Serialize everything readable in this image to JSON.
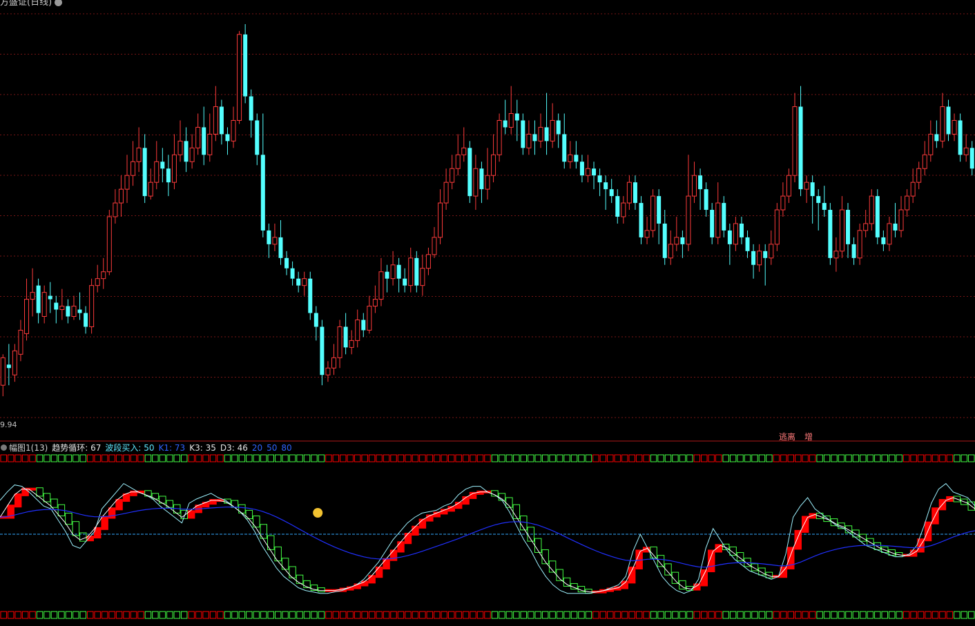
{
  "title": "方盛证(日线)",
  "price_axis_label": "9.94",
  "signals": [
    {
      "text": "逃离"
    },
    {
      "text": "增"
    }
  ],
  "indicator": {
    "name": "幅图1(13)",
    "values": [
      {
        "label": "趋势循环: 67",
        "color": "#e6e6e6"
      },
      {
        "label": "波段买入: 50",
        "color": "#5fe8ff"
      },
      {
        "label": "K1: 73",
        "color": "#2e64ff"
      },
      {
        "label": "K3: 35",
        "color": "#e6e6e6"
      },
      {
        "label": "D3: 46",
        "color": "#e6e6e6"
      },
      {
        "label": "20",
        "color": "#2e64ff"
      },
      {
        "label": "50",
        "color": "#2e64ff"
      },
      {
        "label": "80",
        "color": "#2e64ff"
      }
    ]
  },
  "colors": {
    "up": "#ff3b3b",
    "down": "#54ffff",
    "grid": "#7a1616",
    "cycle_up": "#ff0000",
    "cycle_down": "#44ff44",
    "k_line": "#9ef2ff",
    "d_line": "#ffffff",
    "slow_line": "#2030ff",
    "mid_line": "#33aaff"
  },
  "chart_data": {
    "type": "candlestick",
    "price_range": [
      9.6,
      15.5
    ],
    "candles": [
      [
        10.1,
        10.5,
        10.55,
        9.94
      ],
      [
        10.4,
        10.35,
        10.7,
        10.1
      ],
      [
        10.25,
        10.6,
        10.7,
        10.15
      ],
      [
        10.55,
        10.9,
        11.05,
        10.45
      ],
      [
        10.85,
        11.35,
        11.65,
        10.75
      ],
      [
        11.35,
        11.45,
        11.8,
        11.1
      ],
      [
        11.55,
        11.15,
        11.65,
        11.0
      ],
      [
        11.1,
        11.45,
        11.55,
        11.0
      ],
      [
        11.4,
        11.35,
        11.6,
        11.15
      ],
      [
        11.3,
        11.2,
        11.4,
        11.0
      ],
      [
        11.2,
        11.25,
        11.5,
        11.05
      ],
      [
        11.25,
        11.1,
        11.35,
        11.0
      ],
      [
        11.1,
        11.25,
        11.4,
        11.05
      ],
      [
        11.2,
        11.15,
        11.45,
        11.05
      ],
      [
        11.15,
        10.95,
        11.25,
        10.85
      ],
      [
        10.95,
        11.55,
        11.65,
        10.85
      ],
      [
        11.55,
        11.65,
        11.85,
        11.45
      ],
      [
        11.65,
        11.75,
        11.95,
        11.5
      ],
      [
        11.75,
        12.55,
        12.65,
        11.7
      ],
      [
        12.55,
        12.75,
        12.95,
        12.45
      ],
      [
        12.75,
        12.95,
        13.15,
        12.55
      ],
      [
        12.95,
        13.15,
        13.45,
        12.75
      ],
      [
        13.15,
        13.35,
        13.65,
        13.0
      ],
      [
        13.35,
        13.55,
        13.85,
        13.2
      ],
      [
        13.55,
        12.85,
        13.75,
        12.75
      ],
      [
        12.85,
        13.05,
        13.25,
        12.8
      ],
      [
        13.05,
        13.35,
        13.65,
        12.95
      ],
      [
        13.35,
        13.25,
        13.55,
        13.05
      ],
      [
        13.25,
        13.05,
        13.45,
        12.85
      ],
      [
        13.05,
        13.45,
        13.75,
        12.95
      ],
      [
        13.45,
        13.65,
        13.95,
        13.35
      ],
      [
        13.65,
        13.35,
        13.85,
        13.2
      ],
      [
        13.35,
        13.55,
        13.75,
        13.25
      ],
      [
        13.55,
        13.85,
        14.05,
        13.45
      ],
      [
        13.85,
        13.45,
        14.15,
        13.3
      ],
      [
        13.45,
        13.75,
        14.05,
        13.35
      ],
      [
        13.75,
        14.15,
        14.45,
        13.65
      ],
      [
        14.15,
        13.75,
        14.25,
        13.6
      ],
      [
        13.75,
        13.65,
        13.85,
        13.45
      ],
      [
        13.65,
        13.95,
        14.15,
        13.55
      ],
      [
        13.95,
        15.2,
        15.25,
        13.9
      ],
      [
        15.2,
        14.3,
        15.35,
        14.2
      ],
      [
        14.3,
        13.95,
        14.4,
        13.7
      ],
      [
        13.95,
        13.45,
        14.05,
        13.3
      ],
      [
        13.45,
        12.35,
        14.05,
        12.25
      ],
      [
        12.35,
        12.15,
        12.45,
        11.95
      ],
      [
        12.15,
        12.25,
        12.45,
        12.05
      ],
      [
        12.25,
        11.95,
        12.5,
        11.85
      ],
      [
        11.95,
        11.8,
        12.05,
        11.7
      ],
      [
        11.8,
        11.65,
        11.9,
        11.55
      ],
      [
        11.65,
        11.55,
        11.75,
        11.45
      ],
      [
        11.55,
        11.65,
        11.75,
        11.4
      ],
      [
        11.65,
        11.15,
        11.75,
        11.05
      ],
      [
        11.15,
        10.95,
        11.25,
        10.75
      ],
      [
        10.95,
        10.25,
        11.05,
        10.1
      ],
      [
        10.25,
        10.35,
        10.45,
        10.15
      ],
      [
        10.35,
        10.5,
        10.7,
        10.25
      ],
      [
        10.5,
        10.95,
        11.05,
        10.35
      ],
      [
        10.95,
        10.65,
        11.15,
        10.55
      ],
      [
        10.65,
        10.75,
        10.9,
        10.55
      ],
      [
        10.75,
        11.05,
        11.2,
        10.65
      ],
      [
        11.05,
        10.9,
        11.15,
        10.8
      ],
      [
        10.9,
        11.25,
        11.4,
        10.85
      ],
      [
        11.25,
        11.35,
        11.55,
        11.15
      ],
      [
        11.35,
        11.75,
        11.95,
        11.25
      ],
      [
        11.75,
        11.65,
        11.85,
        11.45
      ],
      [
        11.65,
        11.85,
        12.05,
        11.55
      ],
      [
        11.85,
        11.65,
        11.95,
        11.45
      ],
      [
        11.65,
        11.55,
        11.8,
        11.45
      ],
      [
        11.55,
        11.95,
        12.1,
        11.45
      ],
      [
        11.95,
        11.55,
        12.05,
        11.45
      ],
      [
        11.55,
        11.8,
        12.0,
        11.4
      ],
      [
        11.8,
        12.0,
        12.1,
        11.7
      ],
      [
        12.0,
        12.25,
        12.4,
        11.95
      ],
      [
        12.25,
        12.75,
        12.95,
        12.15
      ],
      [
        12.75,
        13.05,
        13.25,
        12.65
      ],
      [
        13.05,
        13.25,
        13.45,
        12.95
      ],
      [
        13.25,
        13.45,
        13.75,
        13.15
      ],
      [
        13.45,
        13.55,
        13.85,
        13.35
      ],
      [
        13.55,
        12.85,
        13.65,
        12.75
      ],
      [
        12.85,
        13.25,
        13.45,
        12.65
      ],
      [
        13.25,
        12.95,
        13.35,
        12.75
      ],
      [
        12.95,
        13.15,
        13.55,
        12.8
      ],
      [
        13.15,
        13.45,
        13.75,
        13.05
      ],
      [
        13.45,
        13.95,
        14.05,
        13.35
      ],
      [
        13.95,
        13.85,
        14.25,
        13.75
      ],
      [
        13.85,
        14.05,
        14.45,
        13.75
      ],
      [
        14.05,
        13.95,
        14.25,
        13.65
      ],
      [
        13.95,
        13.55,
        14.05,
        13.45
      ],
      [
        13.55,
        13.75,
        13.95,
        13.45
      ],
      [
        13.75,
        13.65,
        13.95,
        13.45
      ],
      [
        13.65,
        13.85,
        14.05,
        13.55
      ],
      [
        13.85,
        13.65,
        14.35,
        13.45
      ],
      [
        13.65,
        13.95,
        14.2,
        13.55
      ],
      [
        13.95,
        13.75,
        14.05,
        13.55
      ],
      [
        13.75,
        13.35,
        14.05,
        13.25
      ],
      [
        13.35,
        13.45,
        13.65,
        13.25
      ],
      [
        13.45,
        13.35,
        13.65,
        13.25
      ],
      [
        13.35,
        13.15,
        13.45,
        13.05
      ],
      [
        13.15,
        13.25,
        13.45,
        13.05
      ],
      [
        13.25,
        13.15,
        13.35,
        12.95
      ],
      [
        13.15,
        13.05,
        13.25,
        12.85
      ],
      [
        13.05,
        12.95,
        13.15,
        12.65
      ],
      [
        12.95,
        12.85,
        13.1,
        12.75
      ],
      [
        12.85,
        12.55,
        12.95,
        12.45
      ],
      [
        12.55,
        12.75,
        12.85,
        12.45
      ],
      [
        12.75,
        13.05,
        13.15,
        12.65
      ],
      [
        13.05,
        12.75,
        13.15,
        12.65
      ],
      [
        12.75,
        12.25,
        12.85,
        12.15
      ],
      [
        12.25,
        12.35,
        12.55,
        12.15
      ],
      [
        12.35,
        12.85,
        12.95,
        12.25
      ],
      [
        12.85,
        12.45,
        12.95,
        12.15
      ],
      [
        12.45,
        11.95,
        12.65,
        11.85
      ],
      [
        11.95,
        12.15,
        12.35,
        11.85
      ],
      [
        12.15,
        12.25,
        12.55,
        12.05
      ],
      [
        12.25,
        12.15,
        12.35,
        11.95
      ],
      [
        12.15,
        12.85,
        13.45,
        12.05
      ],
      [
        12.85,
        13.15,
        13.35,
        12.75
      ],
      [
        13.15,
        12.95,
        13.25,
        12.65
      ],
      [
        12.95,
        12.65,
        13.05,
        12.55
      ],
      [
        12.65,
        12.25,
        12.75,
        12.15
      ],
      [
        12.25,
        12.75,
        13.05,
        12.15
      ],
      [
        12.75,
        12.35,
        12.85,
        12.25
      ],
      [
        12.35,
        12.15,
        12.45,
        11.85
      ],
      [
        12.15,
        12.45,
        12.55,
        12.05
      ],
      [
        12.45,
        12.25,
        12.55,
        12.15
      ],
      [
        12.25,
        12.05,
        12.35,
        11.95
      ],
      [
        12.05,
        11.85,
        12.15,
        11.65
      ],
      [
        11.85,
        12.05,
        12.15,
        11.75
      ],
      [
        12.05,
        11.95,
        12.15,
        11.55
      ],
      [
        11.95,
        12.15,
        12.35,
        11.85
      ],
      [
        12.15,
        12.65,
        12.75,
        12.05
      ],
      [
        12.65,
        12.85,
        13.05,
        12.55
      ],
      [
        12.85,
        13.15,
        13.25,
        12.75
      ],
      [
        13.15,
        14.15,
        14.35,
        13.05
      ],
      [
        14.15,
        12.95,
        14.45,
        12.85
      ],
      [
        12.95,
        13.05,
        13.15,
        12.75
      ],
      [
        13.05,
        12.85,
        13.15,
        12.45
      ],
      [
        12.85,
        12.75,
        12.95,
        12.35
      ],
      [
        12.75,
        12.65,
        13.0,
        12.55
      ],
      [
        12.65,
        11.95,
        12.75,
        11.85
      ],
      [
        11.95,
        12.05,
        12.25,
        11.75
      ],
      [
        12.05,
        12.65,
        12.85,
        11.95
      ],
      [
        12.65,
        12.15,
        12.75,
        11.95
      ],
      [
        12.15,
        11.95,
        12.25,
        11.85
      ],
      [
        11.95,
        12.35,
        12.45,
        11.85
      ],
      [
        12.35,
        12.45,
        12.65,
        12.25
      ],
      [
        12.45,
        12.85,
        12.95,
        12.35
      ],
      [
        12.85,
        12.25,
        12.95,
        12.15
      ],
      [
        12.25,
        12.15,
        12.35,
        12.05
      ],
      [
        12.15,
        12.45,
        12.55,
        12.05
      ],
      [
        12.45,
        12.35,
        12.75,
        12.25
      ],
      [
        12.35,
        12.65,
        12.85,
        12.25
      ],
      [
        12.65,
        12.85,
        12.95,
        12.55
      ],
      [
        12.85,
        13.05,
        13.25,
        12.75
      ],
      [
        13.05,
        13.25,
        13.35,
        12.95
      ],
      [
        13.25,
        13.45,
        13.65,
        13.15
      ],
      [
        13.45,
        13.75,
        13.95,
        13.35
      ],
      [
        13.75,
        13.65,
        13.95,
        13.55
      ],
      [
        13.65,
        14.15,
        14.35,
        13.55
      ],
      [
        14.15,
        13.75,
        14.25,
        13.65
      ],
      [
        13.75,
        13.95,
        14.05,
        13.65
      ],
      [
        13.95,
        13.45,
        14.05,
        13.35
      ],
      [
        13.45,
        13.55,
        13.75,
        13.35
      ],
      [
        13.55,
        13.25,
        13.65,
        13.15
      ]
    ],
    "indicator_range": [
      0,
      100
    ],
    "k_fast": [
      74,
      80,
      85,
      84,
      80,
      75,
      70,
      68,
      60,
      52,
      42,
      40,
      46,
      52,
      68,
      74,
      80,
      86,
      83,
      80,
      78,
      75,
      70,
      66,
      62,
      58,
      72,
      75,
      77,
      79,
      76,
      74,
      70,
      66,
      60,
      52,
      42,
      34,
      26,
      20,
      16,
      12,
      10,
      9,
      8,
      8,
      9,
      10,
      12,
      14,
      18,
      24,
      30,
      38,
      46,
      52,
      58,
      62,
      65,
      66,
      67,
      70,
      72,
      78,
      82,
      84,
      84,
      80,
      78,
      74,
      66,
      56,
      46,
      38,
      28,
      20,
      14,
      10,
      8,
      8,
      8,
      8,
      9,
      10,
      12,
      14,
      20,
      38,
      50,
      40,
      30,
      20,
      14,
      10,
      8,
      10,
      18,
      40,
      54,
      46,
      38,
      32,
      28,
      24,
      22,
      20,
      18,
      20,
      36,
      62,
      70,
      76,
      68,
      64,
      60,
      56,
      54,
      50,
      46,
      42,
      40,
      38,
      36,
      34,
      34,
      36,
      42,
      56,
      72,
      82,
      86,
      80,
      78,
      76,
      70
    ],
    "k_slow": [
      62,
      70,
      78,
      82,
      82,
      78,
      74,
      70,
      64,
      58,
      50,
      46,
      48,
      54,
      62,
      68,
      74,
      78,
      80,
      80,
      78,
      76,
      73,
      70,
      66,
      62,
      66,
      70,
      72,
      74,
      74,
      73,
      70,
      66,
      62,
      56,
      48,
      40,
      32,
      26,
      20,
      16,
      13,
      11,
      10,
      10,
      10,
      11,
      12,
      14,
      16,
      20,
      26,
      32,
      38,
      44,
      50,
      55,
      60,
      63,
      65,
      67,
      69,
      72,
      76,
      79,
      80,
      80,
      78,
      75,
      70,
      62,
      54,
      46,
      38,
      30,
      24,
      18,
      14,
      12,
      10,
      9,
      9,
      10,
      11,
      12,
      16,
      26,
      38,
      40,
      34,
      28,
      22,
      16,
      12,
      11,
      14,
      24,
      38,
      42,
      40,
      36,
      32,
      28,
      25,
      22,
      20,
      20,
      26,
      40,
      52,
      62,
      64,
      62,
      60,
      57,
      55,
      52,
      49,
      46,
      43,
      40,
      38,
      36,
      35,
      35,
      38,
      46,
      58,
      68,
      74,
      76,
      74,
      72,
      68
    ]
  }
}
